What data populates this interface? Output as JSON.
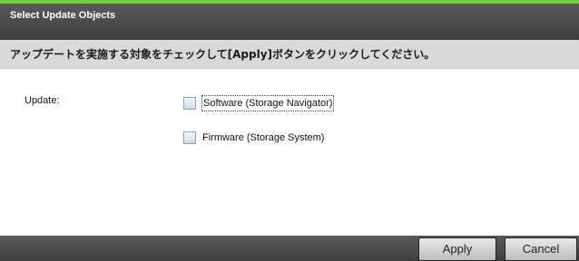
{
  "dialog": {
    "title": "Select Update Objects",
    "instruction": "アップデートを実施する対象をチェックして[Apply]ボタンをクリックしてください。",
    "accent_color": "#7ac943"
  },
  "form": {
    "update_label": "Update:",
    "options": [
      {
        "label": "Software (Storage Navigator)",
        "checked": false,
        "focused": true
      },
      {
        "label": "Firmware (Storage System)",
        "checked": false,
        "focused": false
      }
    ]
  },
  "footer": {
    "apply_label": "Apply",
    "cancel_label": "Cancel"
  }
}
